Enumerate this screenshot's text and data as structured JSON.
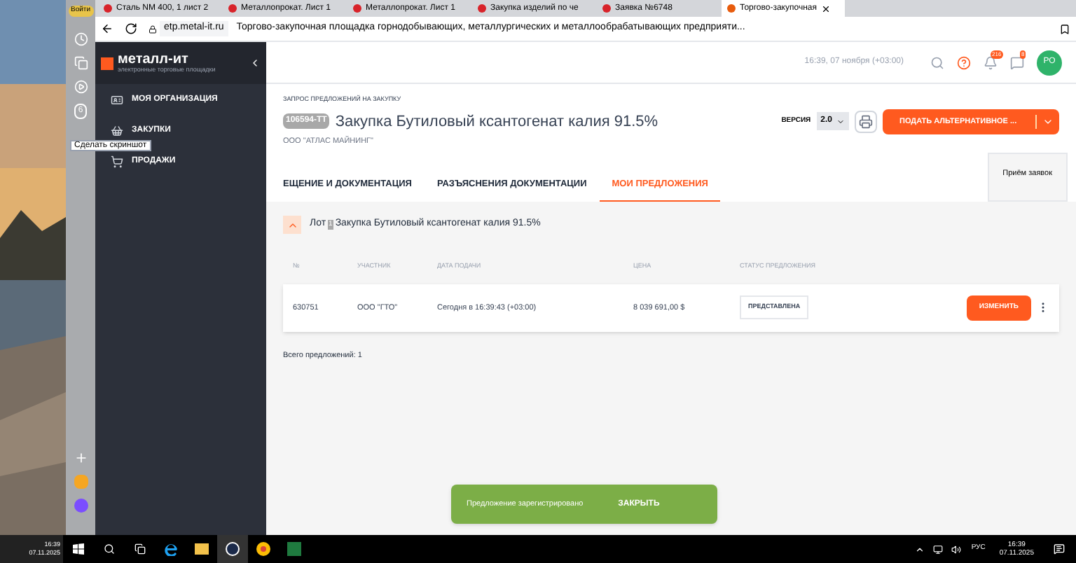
{
  "browser": {
    "login_badge": "Войти",
    "tabs": [
      {
        "title": "Сталь NM 400, 1 лист 2",
        "selected": false
      },
      {
        "title": "Металлопрокат. Лист 1",
        "selected": false
      },
      {
        "title": "Металлопрокат. Лист 1",
        "selected": false
      },
      {
        "title": "Закупка изделий по че",
        "selected": false
      },
      {
        "title": "Заявка №6748",
        "selected": false
      },
      {
        "title": "Торгово-закупочная",
        "selected": true
      }
    ],
    "url": "etp.metal-it.ru",
    "page_title": "Торгово-закупочная площадка горнодобывающих, металлургических и металлообрабатывающих предприяти...",
    "sidebar_badge": "6",
    "tooltip": "Сделать скриншот"
  },
  "app": {
    "logo": "металл-ит",
    "logo_sub": "электронные торговые площадки",
    "time": "16:39, 07 ноября (+03:00)",
    "notifications": "216",
    "messages": "8",
    "avatar": "РО",
    "menu": [
      {
        "label": "МОЯ ОРГАНИЗАЦИЯ"
      },
      {
        "label": "ЗАКУПКИ"
      },
      {
        "label": "ПРОДАЖИ"
      }
    ],
    "breadcrumb": "ЗАПРОС ПРЕДЛОЖЕНИЙ НА ЗАКУПКУ",
    "code": "106594-ТТ",
    "title": "Закупка Бутиловый ксантогенат калия 91.5%",
    "company": "ООО \"АТЛАС МАЙНИНГ\"",
    "version_label": "ВЕРСИЯ",
    "version": "2.0",
    "submit": "ПОДАТЬ АЛЬТЕРНАТИВНОЕ ...",
    "tabs": [
      {
        "label": "ЕЩЕНИЕ И ДОКУМЕНТАЦИЯ",
        "selected": false
      },
      {
        "label": "РАЗЪЯСНЕНИЯ ДОКУМЕНТАЦИИ",
        "selected": false
      },
      {
        "label": "МОИ ПРЕДЛОЖЕНИЯ",
        "selected": true
      }
    ],
    "stage": "Приём заявок",
    "lot": {
      "expanded": true,
      "prefix": "Лот",
      "number": "1",
      "title": "Закупка Бутиловый ксантогенат калия 91.5%"
    },
    "columns": [
      "№",
      "УЧАСТНИК",
      "ДАТА ПОДАЧИ",
      "ЦЕНА",
      "СТАТУС ПРЕДЛОЖЕНИЯ"
    ],
    "rows": [
      {
        "number": "630751",
        "participant": "ООО \"ГТО\"",
        "date": "Сегодня в 16:39:43 (+03:00)",
        "price": "8 039 691,00 $",
        "status": "ПРЕДСТАВЛЕНА",
        "action": "ИЗМЕНИТЬ"
      }
    ],
    "total": "Всего предложений: 1",
    "toast": {
      "message": "Предложение зарегистрировано",
      "action": "ЗАКРЫТЬ"
    }
  },
  "taskbar": {
    "left_time": "16:39",
    "left_date": "07.11.2025",
    "lang": "РУС",
    "time": "16:39",
    "date": "07.11.2025"
  }
}
